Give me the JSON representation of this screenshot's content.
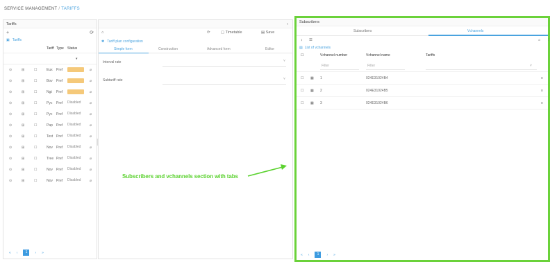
{
  "breadcrumb": {
    "root": "SERVICE MANAGEMENT",
    "separator": "/",
    "current": "TARIFFS"
  },
  "tariffs_panel": {
    "title": "Tariffs",
    "add_label": "+",
    "refresh_icon": "refresh-icon",
    "tree_link": "Tariffs",
    "columns": [
      "Tariff",
      "Type",
      "Status"
    ],
    "status_dropdown": "▾",
    "rows": [
      {
        "c1": "⊙",
        "c2": "⊞",
        "c3": "☐",
        "name": "Eux",
        "type": "Pref",
        "status": "Active",
        "status_style": "active",
        "action": "⌀"
      },
      {
        "c1": "⊙",
        "c2": "⊞",
        "c3": "☐",
        "name": "Bov",
        "type": "Pref",
        "status": "Active",
        "status_style": "active",
        "action": "⌀"
      },
      {
        "c1": "⊙",
        "c2": "⊞",
        "c3": "☐",
        "name": "Ngt",
        "type": "Pref",
        "status": "Active",
        "status_style": "active",
        "action": "⌀"
      },
      {
        "c1": "⊙",
        "c2": "⊞",
        "c3": "☐",
        "name": "Pyc",
        "type": "Pref",
        "status": "Disabled",
        "status_style": "disabled",
        "action": "⌀"
      },
      {
        "c1": "⊙",
        "c2": "⊞",
        "c3": "☐",
        "name": "Pyc",
        "type": "Pref",
        "status": "Disabled",
        "status_style": "disabled",
        "action": "⌀"
      },
      {
        "c1": "⊙",
        "c2": "⊞",
        "c3": "☐",
        "name": "Pap",
        "type": "Pref",
        "status": "Disabled",
        "status_style": "disabled",
        "action": "⌀"
      },
      {
        "c1": "⊙",
        "c2": "⊞",
        "c3": "☐",
        "name": "Test",
        "type": "Pref",
        "status": "Disabled",
        "status_style": "disabled",
        "action": "⌀"
      },
      {
        "c1": "⊙",
        "c2": "⊞",
        "c3": "☐",
        "name": "Nov",
        "type": "Pref",
        "status": "Disabled",
        "status_style": "disabled",
        "action": "⌀"
      },
      {
        "c1": "⊙",
        "c2": "⊞",
        "c3": "☐",
        "name": "Tree",
        "type": "Pref",
        "status": "Disabled",
        "status_style": "disabled",
        "action": "⌀"
      },
      {
        "c1": "⊙",
        "c2": "⊞",
        "c3": "☐",
        "name": "Nov",
        "type": "Pref",
        "status": "Disabled",
        "status_style": "disabled",
        "action": "⌀"
      },
      {
        "c1": "⊙",
        "c2": "⊞",
        "c3": "☐",
        "name": "Nov",
        "type": "Pref",
        "status": "Disabled",
        "status_style": "disabled",
        "action": "⌀"
      }
    ],
    "pager": {
      "first": "«",
      "prev": "‹",
      "page": "1",
      "next": "›",
      "last": "»"
    }
  },
  "config_panel": {
    "collapse": "‹",
    "toolbar": {
      "home": "⌂",
      "refresh": "⟳",
      "timetable": "Timetable",
      "save": "Save"
    },
    "title": "Tariff plan configuration",
    "tabs": [
      "Simple form",
      "Construction",
      "Advanced form",
      "Editor"
    ],
    "fields": [
      {
        "label": "Interval rate",
        "caret": "˅"
      },
      {
        "label": "Subtariff rate",
        "caret": "˅"
      }
    ]
  },
  "annotation": {
    "text": "Subscribers and vchannels section with tabs"
  },
  "subscribers_panel": {
    "title": "Subscribers",
    "tabs": [
      "Subscribers",
      "Vchannels"
    ],
    "toolbar": {
      "t1": "↕",
      "t2": "☰",
      "home": "⌂",
      "more": "⋮"
    },
    "list_title": "List of vchannels",
    "columns": [
      "Vchannel number",
      "Vchannel name",
      "Tariffs"
    ],
    "filters": [
      "Filter",
      "Filter"
    ],
    "rows": [
      {
        "num": "1",
        "name": "024E31024B4"
      },
      {
        "num": "2",
        "name": "024E31024B5"
      },
      {
        "num": "3",
        "name": "024E31024B6"
      }
    ],
    "row_action": "≡",
    "pager": {
      "first": "«",
      "prev": "‹",
      "page": "1",
      "next": "›",
      "last": "»"
    }
  }
}
